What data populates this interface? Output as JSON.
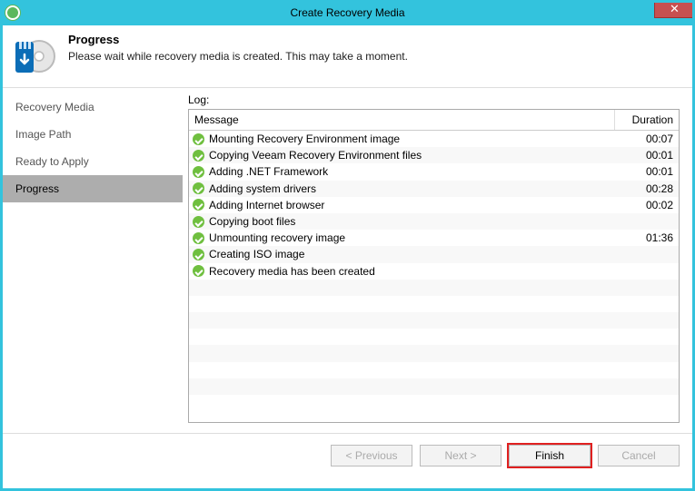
{
  "window": {
    "title": "Create Recovery Media"
  },
  "header": {
    "title": "Progress",
    "subtitle": "Please wait while recovery media is created. This may take a moment."
  },
  "sidebar": {
    "items": [
      {
        "label": "Recovery Media",
        "active": false
      },
      {
        "label": "Image Path",
        "active": false
      },
      {
        "label": "Ready to Apply",
        "active": false
      },
      {
        "label": "Progress",
        "active": true
      }
    ]
  },
  "log": {
    "label": "Log:",
    "columns": {
      "message": "Message",
      "duration": "Duration"
    },
    "rows": [
      {
        "message": "Mounting Recovery Environment image",
        "duration": "00:07"
      },
      {
        "message": "Copying Veeam Recovery Environment files",
        "duration": "00:01"
      },
      {
        "message": "Adding .NET Framework",
        "duration": "00:01"
      },
      {
        "message": "Adding system drivers",
        "duration": "00:28"
      },
      {
        "message": "Adding Internet browser",
        "duration": "00:02"
      },
      {
        "message": "Copying boot files",
        "duration": ""
      },
      {
        "message": "Unmounting recovery image",
        "duration": "01:36"
      },
      {
        "message": "Creating ISO image",
        "duration": ""
      },
      {
        "message": "Recovery media has been created",
        "duration": ""
      }
    ],
    "blank_rows": 8
  },
  "footer": {
    "previous": "< Previous",
    "next": "Next >",
    "finish": "Finish",
    "cancel": "Cancel"
  }
}
